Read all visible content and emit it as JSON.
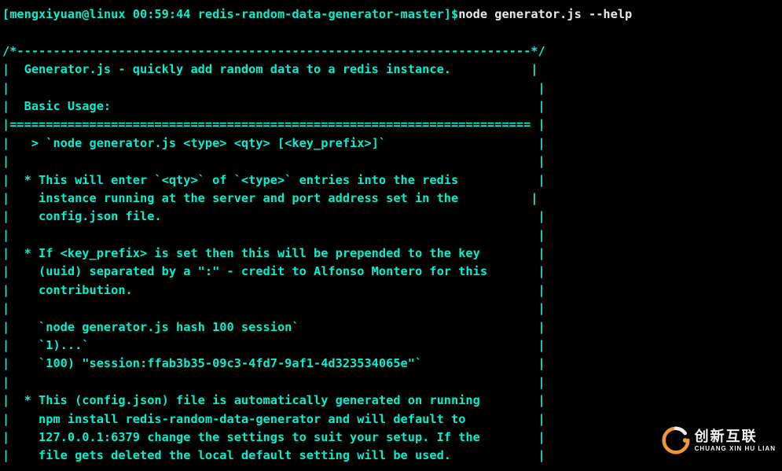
{
  "prompt": {
    "user_host": "[mengxiyuan@linux ",
    "time": "00:59:44 ",
    "dir": "redis-random-data-generator-master]$",
    "command": "node generator.js --help"
  },
  "lines": [
    "",
    "/*-----------------------------------------------------------------------*/",
    "|  Generator.js - quickly add random data to a redis instance.           |",
    "|                                                                         |",
    "|  Basic Usage:                                                           |",
    "|======================================================================== |",
    "|   > `node generator.js <type> <qty> [<key_prefix>]`                     |",
    "|                                                                         |",
    "|  * This will enter `<qty>` of `<type>` entries into the redis           |",
    "|    instance running at the server and port address set in the          |",
    "|    config.json file.                                                    |",
    "|                                                                         |",
    "|  * If <key_prefix> is set then this will be prepended to the key        |",
    "|    (uuid) separated by a \":\" - credit to Alfonso Montero for this       |",
    "|    contribution.                                                        |",
    "|                                                                         |",
    "|    `node generator.js hash 100 session`                                 |",
    "|    `1)...`                                                              |",
    "|    `100) \"session:ffab3b35-09c3-4fd7-9af1-4d323534065e\"`                |",
    "|                                                                         |",
    "|  * This (config.json) file is automatically generated on running        |",
    "|    npm install redis-random-data-generator and will default to          |",
    "|    127.0.0.1:6379 change the settings to suit your setup. If the        |",
    "|    file gets deleted the local default setting will be used.            |"
  ],
  "watermark": {
    "cn": "创新互联",
    "en": "CHUANG XIN HU LIAN"
  }
}
